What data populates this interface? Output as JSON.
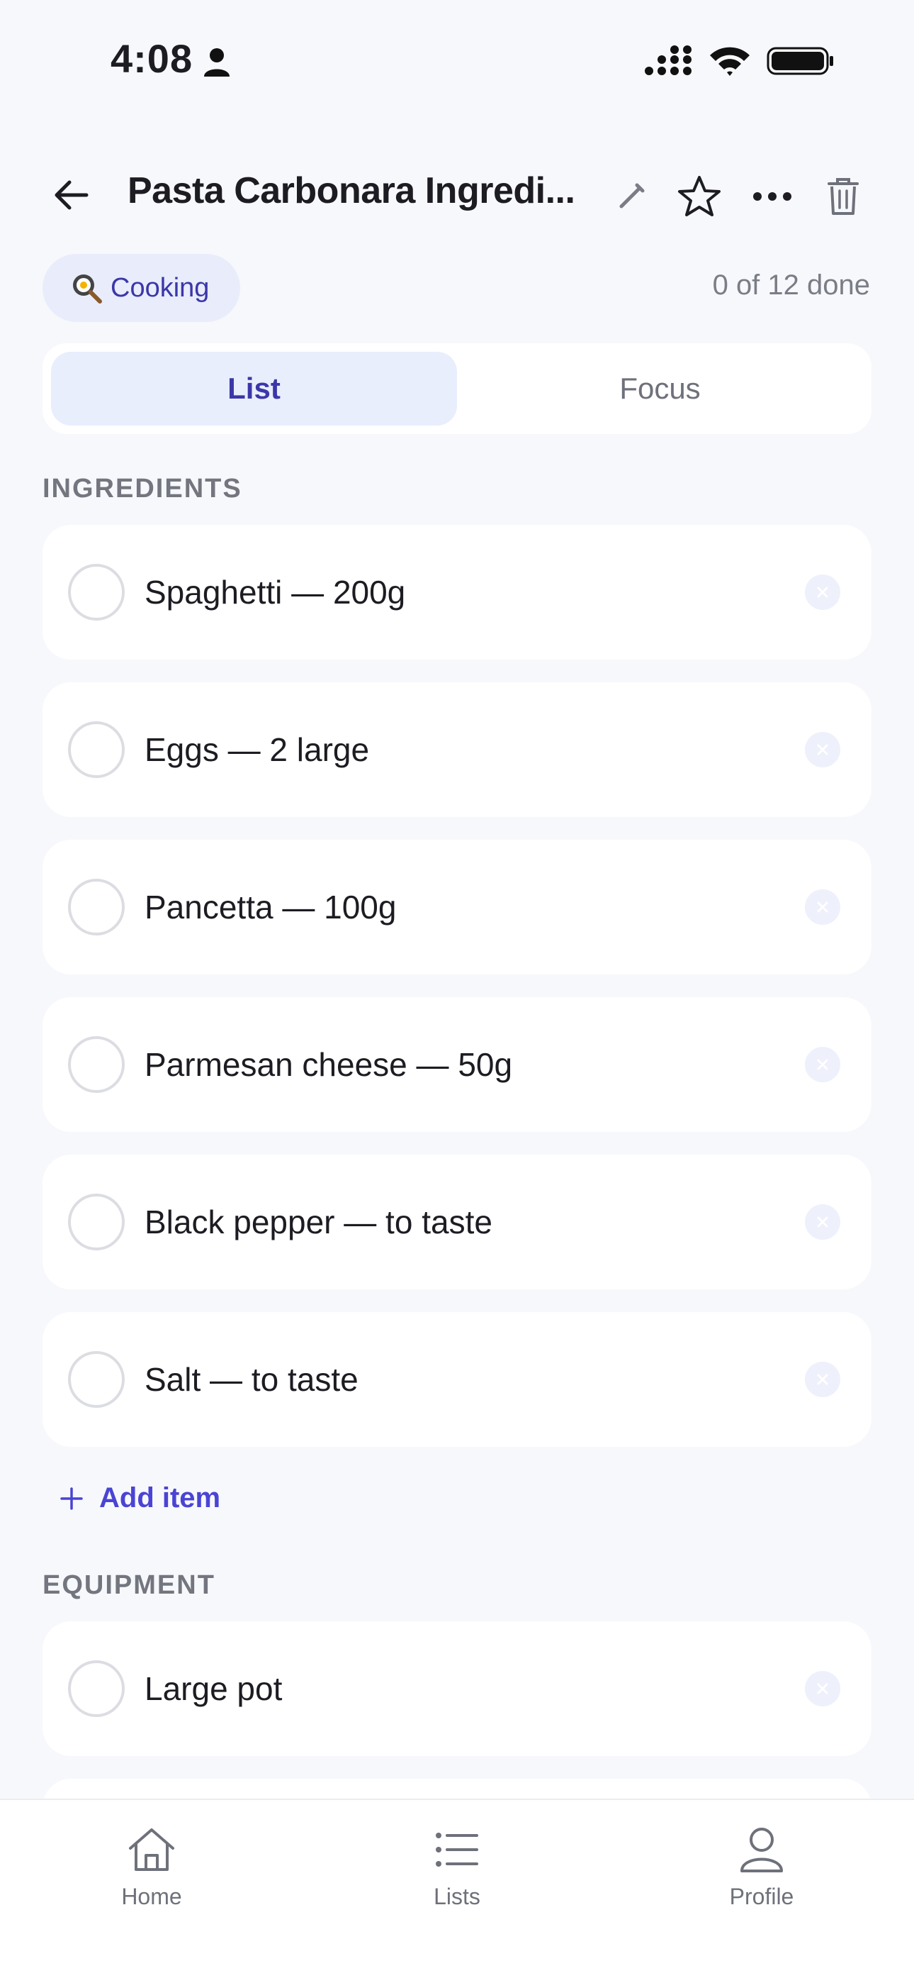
{
  "status_bar": {
    "time": "4:08",
    "icons": [
      "person-icon",
      "signal-icon",
      "wifi-icon",
      "battery-icon"
    ]
  },
  "header": {
    "title": "Pasta Carbonara Ingredi...",
    "actions": [
      "back-arrow-icon",
      "pencil-icon",
      "star-icon",
      "more-icon",
      "trash-icon"
    ]
  },
  "meta": {
    "category": "Cooking",
    "category_icon": "frying-pan-icon",
    "progress": "0 of 12 done"
  },
  "segmented": {
    "tabs": [
      {
        "label": "List",
        "active": true
      },
      {
        "label": "Focus",
        "active": false
      }
    ]
  },
  "sections": [
    {
      "label": "INGREDIENTS",
      "items": [
        {
          "text": "Spaghetti — 200g",
          "done": false
        },
        {
          "text": "Eggs — 2 large",
          "done": false
        },
        {
          "text": "Pancetta — 100g",
          "done": false
        },
        {
          "text": "Parmesan cheese — 50g",
          "done": false
        },
        {
          "text": "Black pepper — to taste",
          "done": false
        },
        {
          "text": "Salt — to taste",
          "done": false
        }
      ],
      "add_label": "Add item"
    },
    {
      "label": "EQUIPMENT",
      "items": [
        {
          "text": "Large pot",
          "done": false
        }
      ]
    }
  ],
  "tab_bar": {
    "tabs": [
      {
        "label": "Home",
        "icon": "home-icon"
      },
      {
        "label": "Lists",
        "icon": "list-icon"
      },
      {
        "label": "Profile",
        "icon": "person-icon"
      }
    ]
  },
  "colors": {
    "accent": "#4a44d4",
    "pill_bg": "#e9ecfb",
    "background": "#f7f8fc"
  }
}
